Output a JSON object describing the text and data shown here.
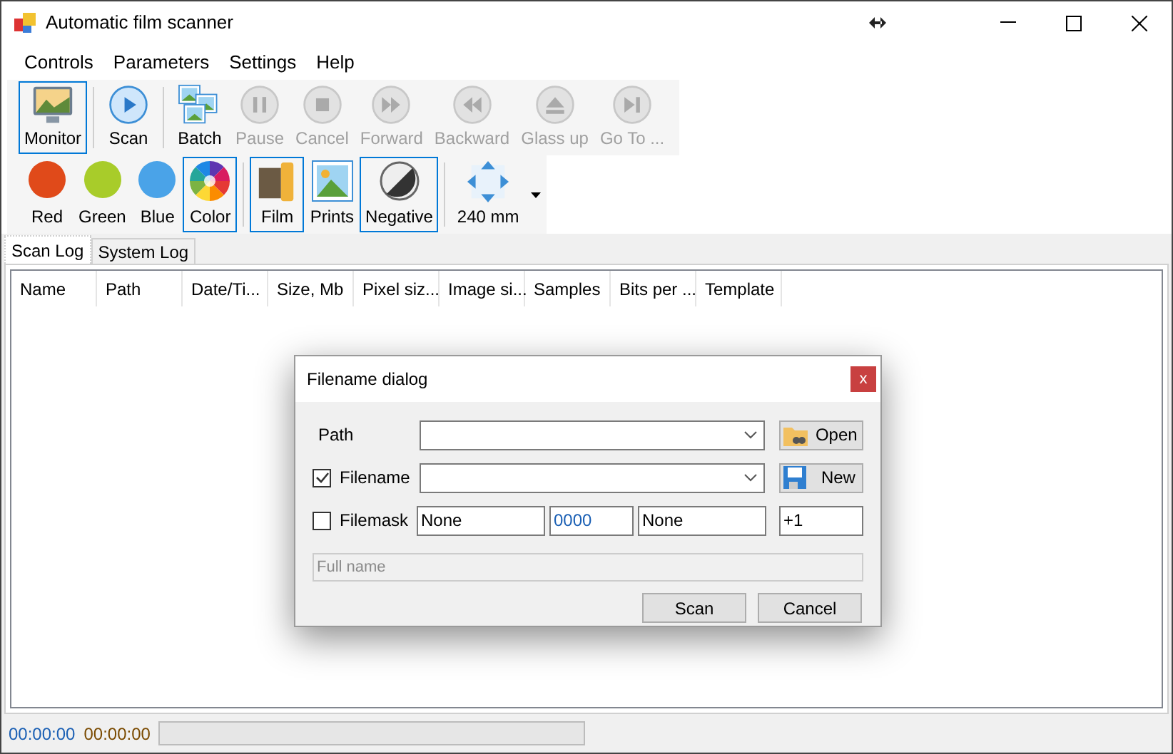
{
  "window": {
    "title": "Automatic film scanner"
  },
  "menu": [
    "Controls",
    "Parameters",
    "Settings",
    "Help"
  ],
  "toolbar_1": [
    {
      "label": "Monitor",
      "kind": "monitor",
      "selected": true,
      "disabled": false
    },
    {
      "label": "Scan",
      "kind": "play",
      "selected": false,
      "disabled": false
    },
    {
      "label": "Batch",
      "kind": "batch",
      "selected": false,
      "disabled": false
    },
    {
      "label": "Pause",
      "kind": "pause",
      "selected": false,
      "disabled": true
    },
    {
      "label": "Cancel",
      "kind": "stop",
      "selected": false,
      "disabled": true
    },
    {
      "label": "Forward",
      "kind": "forward",
      "selected": false,
      "disabled": true
    },
    {
      "label": "Backward",
      "kind": "backward",
      "selected": false,
      "disabled": true
    },
    {
      "label": "Glass up",
      "kind": "eject",
      "selected": false,
      "disabled": true
    },
    {
      "label": "Go To ...",
      "kind": "skip",
      "selected": false,
      "disabled": true
    }
  ],
  "toolbar_2": [
    {
      "label": "Red",
      "kind": "dot",
      "color": "#e04a1a",
      "selected": false
    },
    {
      "label": "Green",
      "kind": "dot",
      "color": "#a8cc2a",
      "selected": false
    },
    {
      "label": "Blue",
      "kind": "dot",
      "color": "#4aa3e8",
      "selected": false
    },
    {
      "label": "Color",
      "kind": "wheel",
      "selected": true
    },
    {
      "label": "Film",
      "kind": "film",
      "selected": true
    },
    {
      "label": "Prints",
      "kind": "print",
      "selected": false
    },
    {
      "label": "Negative",
      "kind": "negative",
      "selected": true
    },
    {
      "label": "240 mm",
      "kind": "size",
      "selected": false
    }
  ],
  "tabs": [
    {
      "label": "Scan Log",
      "selected": true
    },
    {
      "label": "System Log",
      "selected": false
    }
  ],
  "table": {
    "columns": [
      "Name",
      "Path",
      "Date/Ti...",
      "Size, Mb",
      "Pixel siz...",
      "Image si...",
      "Samples",
      "Bits per ...",
      "Template"
    ]
  },
  "dialog": {
    "title": "Filename dialog",
    "close": "x",
    "path": {
      "label": "Path",
      "button": "Open"
    },
    "filename": {
      "label": "Filename",
      "checked": true,
      "button": "New"
    },
    "filemask": {
      "label": "Filemask",
      "checked": false,
      "fields": [
        "None",
        "0000",
        "None"
      ],
      "step": "+1"
    },
    "full_name": {
      "placeholder": "Full name"
    },
    "buttons": [
      "Scan",
      "Cancel"
    ]
  },
  "status_bar": {
    "elapsed": "00:00:00",
    "remaining": "00:00:00",
    "level": 0
  }
}
